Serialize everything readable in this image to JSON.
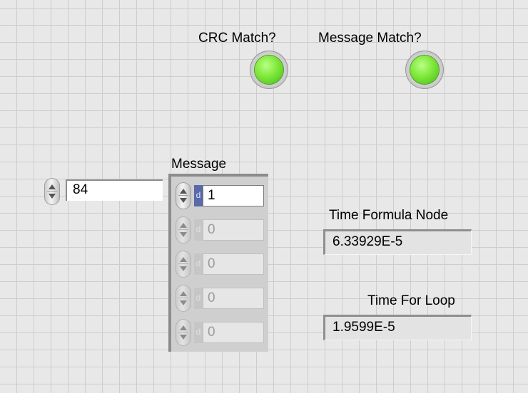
{
  "leds": {
    "crc": {
      "label": "CRC Match?",
      "state": true,
      "color": "#7fe83a"
    },
    "message": {
      "label": "Message Match?",
      "state": true,
      "color": "#7fe83a"
    }
  },
  "control": {
    "value": "84"
  },
  "message_array": {
    "label": "Message",
    "radix_glyph": "d",
    "elements": [
      "1",
      "0",
      "0",
      "0",
      "0"
    ]
  },
  "indicators": {
    "formula": {
      "label": "Time Formula Node",
      "value": "6.33929E-5"
    },
    "loop": {
      "label": "Time For Loop",
      "value": "1.9599E-5"
    }
  }
}
